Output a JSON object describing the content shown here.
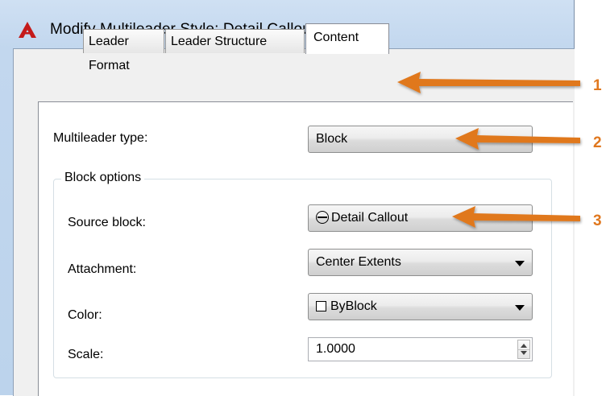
{
  "window": {
    "title": "Modify Multileader Style: Detail Callout",
    "icon": "autocad-logo-icon"
  },
  "tabs": [
    {
      "label": "Leader Format",
      "active": false
    },
    {
      "label": "Leader Structure",
      "active": false
    },
    {
      "label": "Content",
      "active": true
    }
  ],
  "content": {
    "multileader_type": {
      "label": "Multileader type:",
      "value": "Block"
    },
    "block_options": {
      "title": "Block options",
      "source_block": {
        "label": "Source block:",
        "value": "Detail Callout",
        "icon": "circle-block-icon"
      },
      "attachment": {
        "label": "Attachment:",
        "value": "Center Extents"
      },
      "color": {
        "label": "Color:",
        "value": "ByBlock",
        "icon": "square-swatch-icon"
      },
      "scale": {
        "label": "Scale:",
        "value": "1.0000"
      }
    }
  },
  "callouts": [
    {
      "number": "1",
      "target": "tab-content"
    },
    {
      "number": "2",
      "target": "multileader-type-select"
    },
    {
      "number": "3",
      "target": "source-block-select"
    }
  ],
  "colors": {
    "callout": "#e0781f",
    "title_bar": "#c8dcf1",
    "autocad_red": "#c41a1a"
  }
}
